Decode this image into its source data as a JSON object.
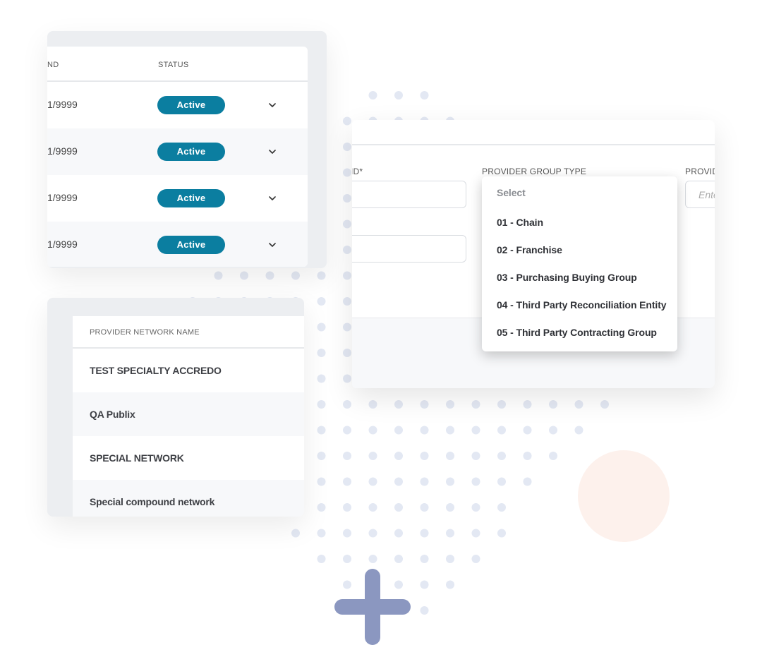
{
  "status_table": {
    "headers": {
      "end": "ND",
      "status": "STATUS"
    },
    "rows": [
      {
        "date": "1/9999",
        "status": "Active"
      },
      {
        "date": "1/9999",
        "status": "Active"
      },
      {
        "date": "1/9999",
        "status": "Active"
      },
      {
        "date": "1/9999",
        "status": "Active"
      }
    ]
  },
  "network_table": {
    "header": "PROVIDER NETWORK NAME",
    "rows": [
      "TEST SPECIALTY ACCREDO",
      "QA Publix",
      "SPECIAL NETWORK",
      "Special compound network"
    ]
  },
  "form": {
    "label_id": "' ID*",
    "label_group_type": "PROVIDER GROUP TYPE",
    "label_provider": "PROVID",
    "input_placeholder": "Ente",
    "dropdown": {
      "placeholder": "Select",
      "options": [
        "01 - Chain",
        "02 - Franchise",
        "03 - Purchasing Buying Group",
        "04 - Third Party Reconciliation Entity",
        "05 - Third Party Contracting Group"
      ]
    }
  },
  "colors": {
    "badge": "#0b7ea0",
    "plus": "#8b97c0",
    "circle": "#fdf1ec",
    "dots": "#e3e8f3"
  }
}
